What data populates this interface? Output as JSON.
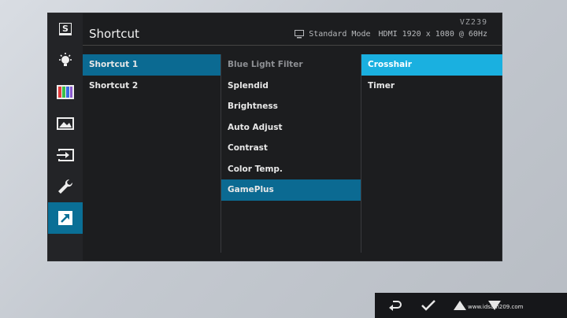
{
  "header": {
    "title": "Shortcut",
    "model": "VZ239",
    "mode": "Standard Mode",
    "input": "HDMI",
    "resolution": "1920 x 1080 @ 60Hz"
  },
  "sidebar": {
    "items": [
      {
        "name": "shortcut-s-icon",
        "label": "S"
      },
      {
        "name": "bluelight-icon"
      },
      {
        "name": "color-icon"
      },
      {
        "name": "image-icon"
      },
      {
        "name": "input-icon"
      },
      {
        "name": "system-setup-icon"
      },
      {
        "name": "shortcut-icon"
      }
    ],
    "active_index": 6
  },
  "menu": {
    "col1": [
      "Shortcut 1",
      "Shortcut 2"
    ],
    "col2": [
      "Blue Light Filter",
      "Splendid",
      "Brightness",
      "Auto Adjust",
      "Contrast",
      "Color Temp.",
      "GamePlus"
    ],
    "col3": [
      "Crosshair",
      "Timer"
    ]
  },
  "keys": [
    "back-icon",
    "check-icon",
    "up-icon",
    "down-icon"
  ],
  "watermark": {
    "text": "",
    "url": "www.idsam209.com"
  }
}
